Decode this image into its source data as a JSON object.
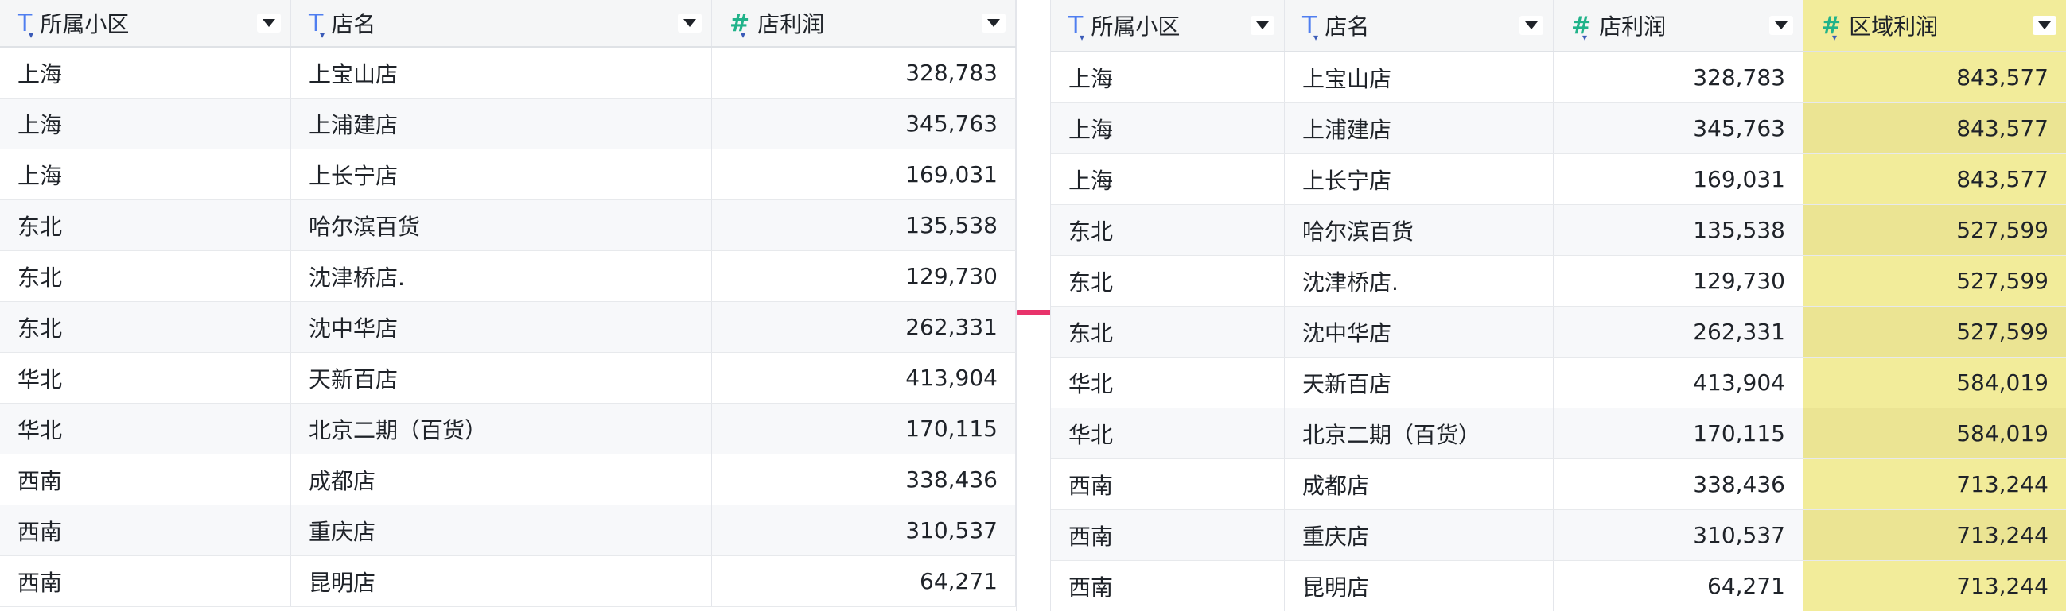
{
  "left_table": {
    "columns": [
      {
        "label": "所属小区",
        "type": "text"
      },
      {
        "label": "店名",
        "type": "text"
      },
      {
        "label": "店利润",
        "type": "number"
      }
    ],
    "rows": [
      [
        "上海",
        "上宝山店",
        "328,783"
      ],
      [
        "上海",
        "上浦建店",
        "345,763"
      ],
      [
        "上海",
        "上长宁店",
        "169,031"
      ],
      [
        "东北",
        "哈尔滨百货",
        "135,538"
      ],
      [
        "东北",
        "沈津桥店.",
        "129,730"
      ],
      [
        "东北",
        "沈中华店",
        "262,331"
      ],
      [
        "华北",
        "天新百店",
        "413,904"
      ],
      [
        "华北",
        "北京二期（百货）",
        "170,115"
      ],
      [
        "西南",
        "成都店",
        "338,436"
      ],
      [
        "西南",
        "重庆店",
        "310,537"
      ],
      [
        "西南",
        "昆明店",
        "64,271"
      ]
    ]
  },
  "right_table": {
    "columns": [
      {
        "label": "所属小区",
        "type": "text"
      },
      {
        "label": "店名",
        "type": "text"
      },
      {
        "label": "店利润",
        "type": "number"
      },
      {
        "label": "区域利润",
        "type": "number",
        "highlighted": true
      }
    ],
    "rows": [
      [
        "上海",
        "上宝山店",
        "328,783",
        "843,577"
      ],
      [
        "上海",
        "上浦建店",
        "345,763",
        "843,577"
      ],
      [
        "上海",
        "上长宁店",
        "169,031",
        "843,577"
      ],
      [
        "东北",
        "哈尔滨百货",
        "135,538",
        "527,599"
      ],
      [
        "东北",
        "沈津桥店.",
        "129,730",
        "527,599"
      ],
      [
        "东北",
        "沈中华店",
        "262,331",
        "527,599"
      ],
      [
        "华北",
        "天新百店",
        "413,904",
        "584,019"
      ],
      [
        "华北",
        "北京二期（百货）",
        "170,115",
        "584,019"
      ],
      [
        "西南",
        "成都店",
        "338,436",
        "713,244"
      ],
      [
        "西南",
        "重庆店",
        "310,537",
        "713,244"
      ],
      [
        "西南",
        "昆明店",
        "64,271",
        "713,244"
      ]
    ]
  },
  "icons": {
    "text_type": "T",
    "number_type": "#",
    "sort_marker": "▾"
  },
  "colors": {
    "highlight": "#f2ec9a",
    "arrow": "#e8336b",
    "text_icon": "#4f7ef0",
    "number_icon": "#21b38a"
  }
}
